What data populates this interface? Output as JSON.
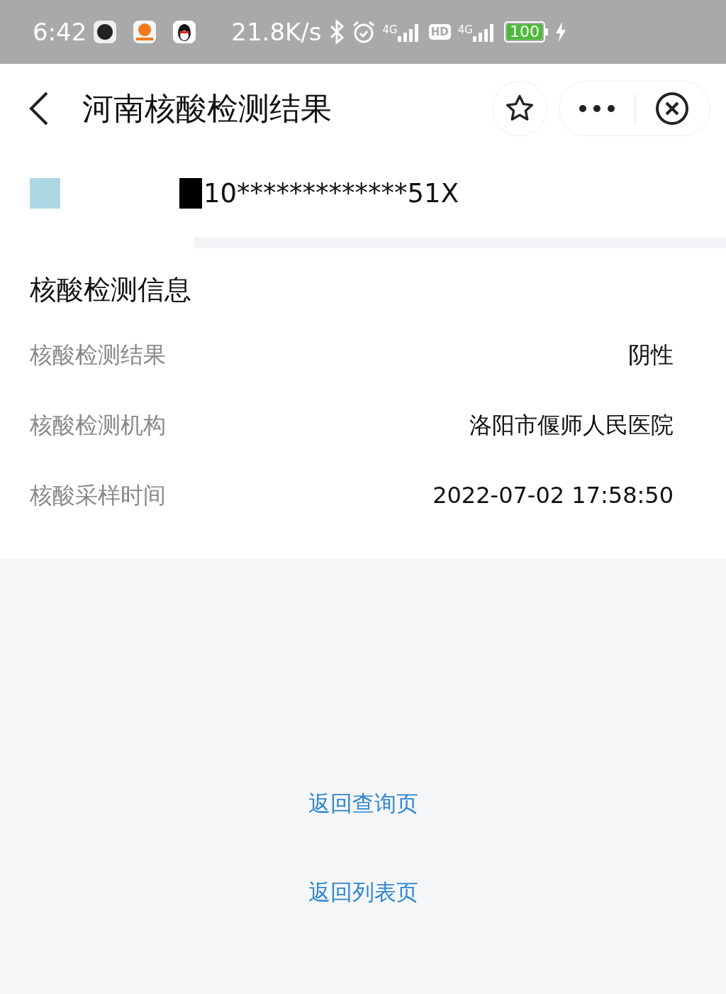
{
  "status_bar": {
    "time": "6:42",
    "speed": "21.8K/s",
    "network_1": "4G",
    "hd": "HD",
    "network_2": "4G",
    "battery": "100",
    "charging": true
  },
  "header": {
    "title": "河南核酸检测结果"
  },
  "id_row": {
    "id_number": "10*************51X"
  },
  "section": {
    "title": "核酸检测信息",
    "rows": [
      {
        "label": "核酸检测结果",
        "value": "阴性"
      },
      {
        "label": "核酸检测机构",
        "value": "洛阳市偃师人民医院"
      },
      {
        "label": "核酸采样时间",
        "value": "2022-07-02 17:58:50"
      }
    ]
  },
  "links": [
    "返回查询页",
    "返回列表页"
  ]
}
